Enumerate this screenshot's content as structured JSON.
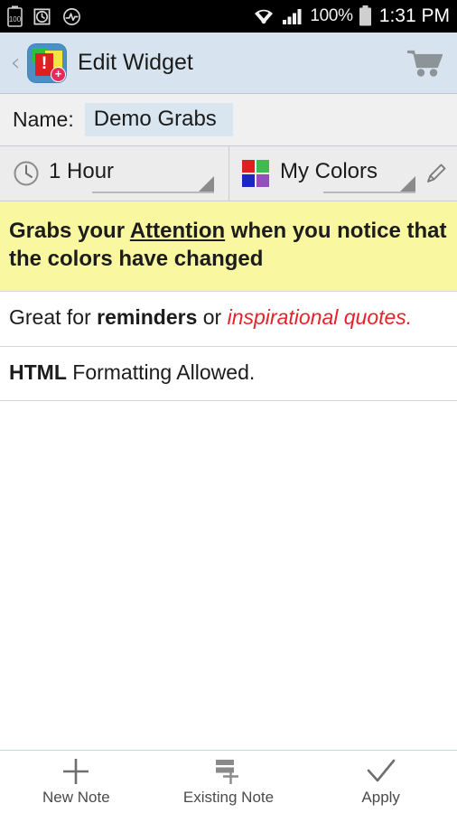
{
  "statusbar": {
    "left_icons": [
      "battery-saver-icon",
      "alarm-clock-icon",
      "activity-pulse-icon"
    ],
    "battery_level_text": "100",
    "wifi_icon": "wifi-icon",
    "signal_icon": "cellular-signal-icon",
    "battery_percent": "100%",
    "battery_icon": "battery-full-icon",
    "time": "1:31 PM"
  },
  "actionbar": {
    "back_label": "‹",
    "app_icon": "app-icon-grabs",
    "bang_glyph": "!",
    "plus_glyph": "+",
    "title": "Edit Widget",
    "cart_icon": "shopping-cart-icon"
  },
  "name_row": {
    "label": "Name:",
    "value": "Demo Grabs",
    "placeholder": "Name"
  },
  "spinners": {
    "interval": {
      "icon": "clock-icon",
      "value": "1 Hour",
      "dropdown_icon": "dropdown-triangle-icon"
    },
    "colors": {
      "icon": "color-palette-grid-icon",
      "value": "My Colors",
      "dropdown_icon": "dropdown-triangle-icon",
      "edit_icon": "pencil-edit-icon",
      "swatches": [
        "#e02020",
        "#3fbb4f",
        "#1c26c4",
        "#9150bb"
      ]
    }
  },
  "notes": [
    {
      "id": "note-attention",
      "highlight": true,
      "background": "#f9f7a0",
      "parts": [
        {
          "text": "Grabs your ",
          "style": "bold"
        },
        {
          "text": "Attention",
          "style": "bold-underline"
        },
        {
          "text": " when you notice that the colors have changed",
          "style": "bold"
        }
      ]
    },
    {
      "id": "note-reminders",
      "highlight": false,
      "parts": [
        {
          "text": "Great for ",
          "style": "normal"
        },
        {
          "text": "reminders",
          "style": "bold"
        },
        {
          "text": " or ",
          "style": "normal"
        },
        {
          "text": "inspirational quotes.",
          "style": "italic-red"
        }
      ]
    },
    {
      "id": "note-html",
      "highlight": false,
      "parts": [
        {
          "text": "HTML",
          "style": "bold"
        },
        {
          "text": " Formatting Allowed.",
          "style": "normal"
        }
      ]
    }
  ],
  "bottombar": {
    "items": [
      {
        "label": "New Note",
        "icon": "plus-icon"
      },
      {
        "label": "Existing Note",
        "icon": "existing-note-plus-icon"
      },
      {
        "label": "Apply",
        "icon": "checkmark-icon"
      }
    ]
  },
  "colors": {
    "accent_header": "#d7e4ef",
    "highlight_yellow": "#f9f7a0",
    "red_text": "#e8212b",
    "name_field": "#d9e5ef"
  }
}
